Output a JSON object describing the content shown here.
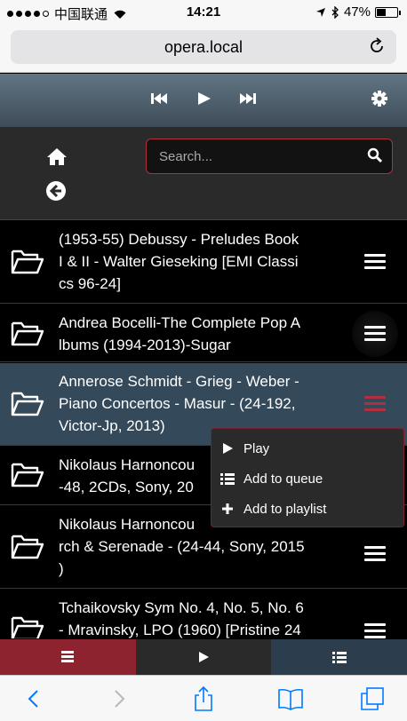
{
  "status_bar": {
    "carrier": "中国联通",
    "time": "14:21",
    "battery": "47%",
    "battery_level": 0.47
  },
  "url_bar": {
    "url": "opera.local",
    "reload_icon": "reload-icon"
  },
  "player": {
    "prev_icon": "skip-back-icon",
    "play_icon": "play-icon",
    "next_icon": "skip-forward-icon",
    "settings_icon": "gear-icon"
  },
  "nav": {
    "home_icon": "home-icon",
    "back_icon": "back-arrow-icon",
    "search_placeholder": "Search...",
    "search_value": ""
  },
  "list": {
    "items": [
      {
        "title": "(1953-55) Debussy - Preludes Book\nI & II - Walter Gieseking [EMI Classi\ncs 96-24]"
      },
      {
        "title": "Andrea Bocelli-The Complete Pop A\nlbums (1994-2013)-Sugar"
      },
      {
        "title": "Annerose Schmidt - Grieg - Weber -\nPiano Concertos - Masur - (24-192,\nVictor-Jp, 2013)"
      },
      {
        "title": "Nikolaus Harnoncou\n-48, 2CDs, Sony, 20"
      },
      {
        "title": "Nikolaus Harnoncou\nrch & Serenade - (24-44, Sony, 2015\n)"
      },
      {
        "title": "Tchaikovsky Sym No. 4, No. 5, No. 6\n- Mravinsky, LPO (1960) [Pristine 24"
      }
    ]
  },
  "context_menu": {
    "items": [
      {
        "label": "Play",
        "icon": "play-icon"
      },
      {
        "label": "Add to queue",
        "icon": "list-icon"
      },
      {
        "label": "Add to playlist",
        "icon": "plus-icon"
      }
    ]
  },
  "bottom_tabs": [
    {
      "icon": "library-icon"
    },
    {
      "icon": "play-icon"
    },
    {
      "icon": "queue-list-icon"
    }
  ],
  "safari_toolbar": {
    "back": "back-chevron-icon",
    "forward": "forward-chevron-icon",
    "share": "share-icon",
    "bookmarks": "bookmarks-icon",
    "tabs": "tabs-icon"
  },
  "colors": {
    "accent_red": "#8e2330",
    "selected_row": "#34495a",
    "header": "#3e4c58",
    "ios_blue": "#007aff"
  }
}
